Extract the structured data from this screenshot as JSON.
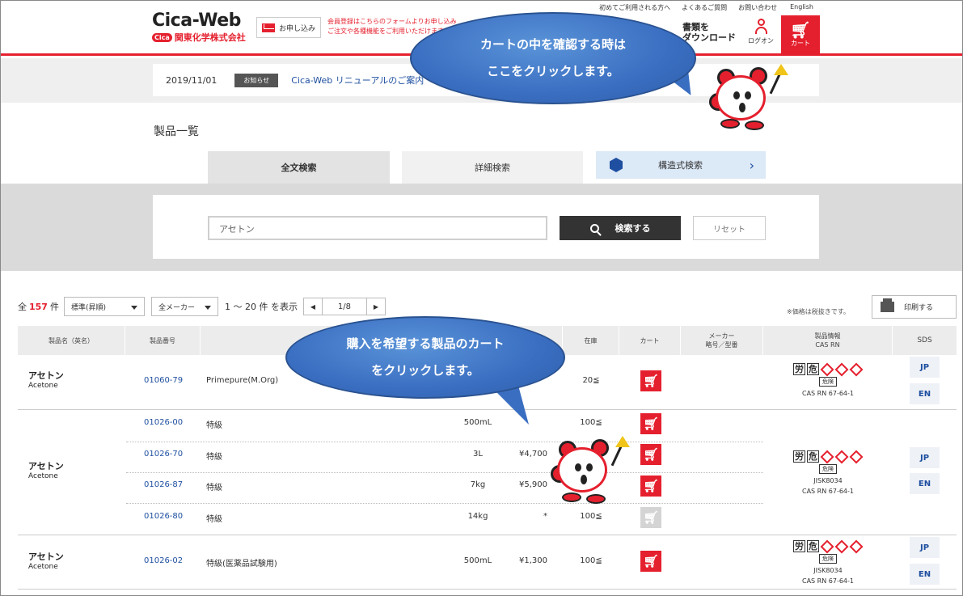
{
  "header": {
    "logo_main": "Cica-Web",
    "logo_badge": "Cica",
    "logo_company": "関東化学株式会社",
    "apply_label": "お申し込み",
    "notice_line1": "会員登録はこちらのフォームよりお申し込み",
    "notice_line2": "ご注文や各種機能をご利用いただけます",
    "toplinks": [
      "初めてご利用される方へ",
      "よくあるご質問",
      "お問い合わせ",
      "English"
    ],
    "doc_download_line1": "書類を",
    "doc_download_line2": "ダウンロード",
    "login_label": "ログオン",
    "cart_label": "カート",
    "cart_icon": "cart-icon"
  },
  "news": {
    "date": "2019/11/01",
    "tag": "お知らせ",
    "link": "Cica-Web リニューアルのご案内"
  },
  "page_title": "製品一覧",
  "tabs": {
    "full_text": "全文検索",
    "detail": "詳細検索",
    "structure": "構造式検索"
  },
  "search": {
    "value": "アセトン",
    "button": "検索する",
    "reset": "リセット"
  },
  "results": {
    "prefix": "全",
    "count": "157",
    "suffix": "件",
    "sort": "標準(昇順)",
    "maker": "全メーカー",
    "range": "1 ～ 20 件 を表示",
    "page": "1/8",
    "tax_note": "※価格は税抜きです。",
    "print": "印刷する"
  },
  "table": {
    "headers": {
      "name": "製品名（英名）",
      "code": "製品番号",
      "stock": "在庫",
      "cart": "カート",
      "maker_line1": "メーカー",
      "maker_line2": "略号／型番",
      "info_line1": "製品情報",
      "info_line2": "CAS RN",
      "sds": "SDS"
    },
    "groups": [
      {
        "name_ja": "アセトン",
        "name_en": "Acetone",
        "rows": [
          {
            "code": "01060-79",
            "grade": "Primepure(M.Org)",
            "capacity": "",
            "price": "",
            "stock": "20≦",
            "cart_enabled": true
          }
        ],
        "ghs_kanji1": "労",
        "ghs_kanji2": "危",
        "signal": "危険",
        "jis": "",
        "cas": "CAS RN 67-64-1",
        "sds_jp": "JP",
        "sds_en": "EN"
      },
      {
        "name_ja": "アセトン",
        "name_en": "Acetone",
        "rows": [
          {
            "code": "01026-00",
            "grade": "特級",
            "capacity": "500mL",
            "price": "",
            "stock": "100≦",
            "cart_enabled": true
          },
          {
            "code": "01026-70",
            "grade": "特級",
            "capacity": "3L",
            "price": "¥4,700",
            "stock": "",
            "cart_enabled": true
          },
          {
            "code": "01026-87",
            "grade": "特級",
            "capacity": "7kg",
            "price": "¥5,900",
            "stock": "",
            "cart_enabled": true
          },
          {
            "code": "01026-80",
            "grade": "特級",
            "capacity": "14kg",
            "price": "*",
            "stock": "100≦",
            "cart_enabled": false
          }
        ],
        "ghs_kanji1": "労",
        "ghs_kanji2": "危",
        "signal": "危険",
        "jis": "JISK8034",
        "cas": "CAS RN 67-64-1",
        "sds_jp": "JP",
        "sds_en": "EN"
      },
      {
        "name_ja": "アセトン",
        "name_en": "Acetone",
        "rows": [
          {
            "code": "01026-02",
            "grade": "特級(医薬品試験用)",
            "capacity": "500mL",
            "price": "¥1,300",
            "stock": "100≦",
            "cart_enabled": true
          }
        ],
        "ghs_kanji1": "労",
        "ghs_kanji2": "危",
        "signal": "危険",
        "jis": "JISK8034",
        "cas": "CAS RN 67-64-1",
        "sds_jp": "JP",
        "sds_en": "EN"
      }
    ]
  },
  "callouts": {
    "top_line1": "カートの中を確認する時は",
    "top_line2": "ここをクリックします。",
    "middle_line1": "購入を希望する製品のカート",
    "middle_line2": "をクリックします。"
  },
  "colors": {
    "brand_red": "#e5202e",
    "link_blue": "#1e4fa0",
    "callout_blue": "#3a6ec1"
  }
}
